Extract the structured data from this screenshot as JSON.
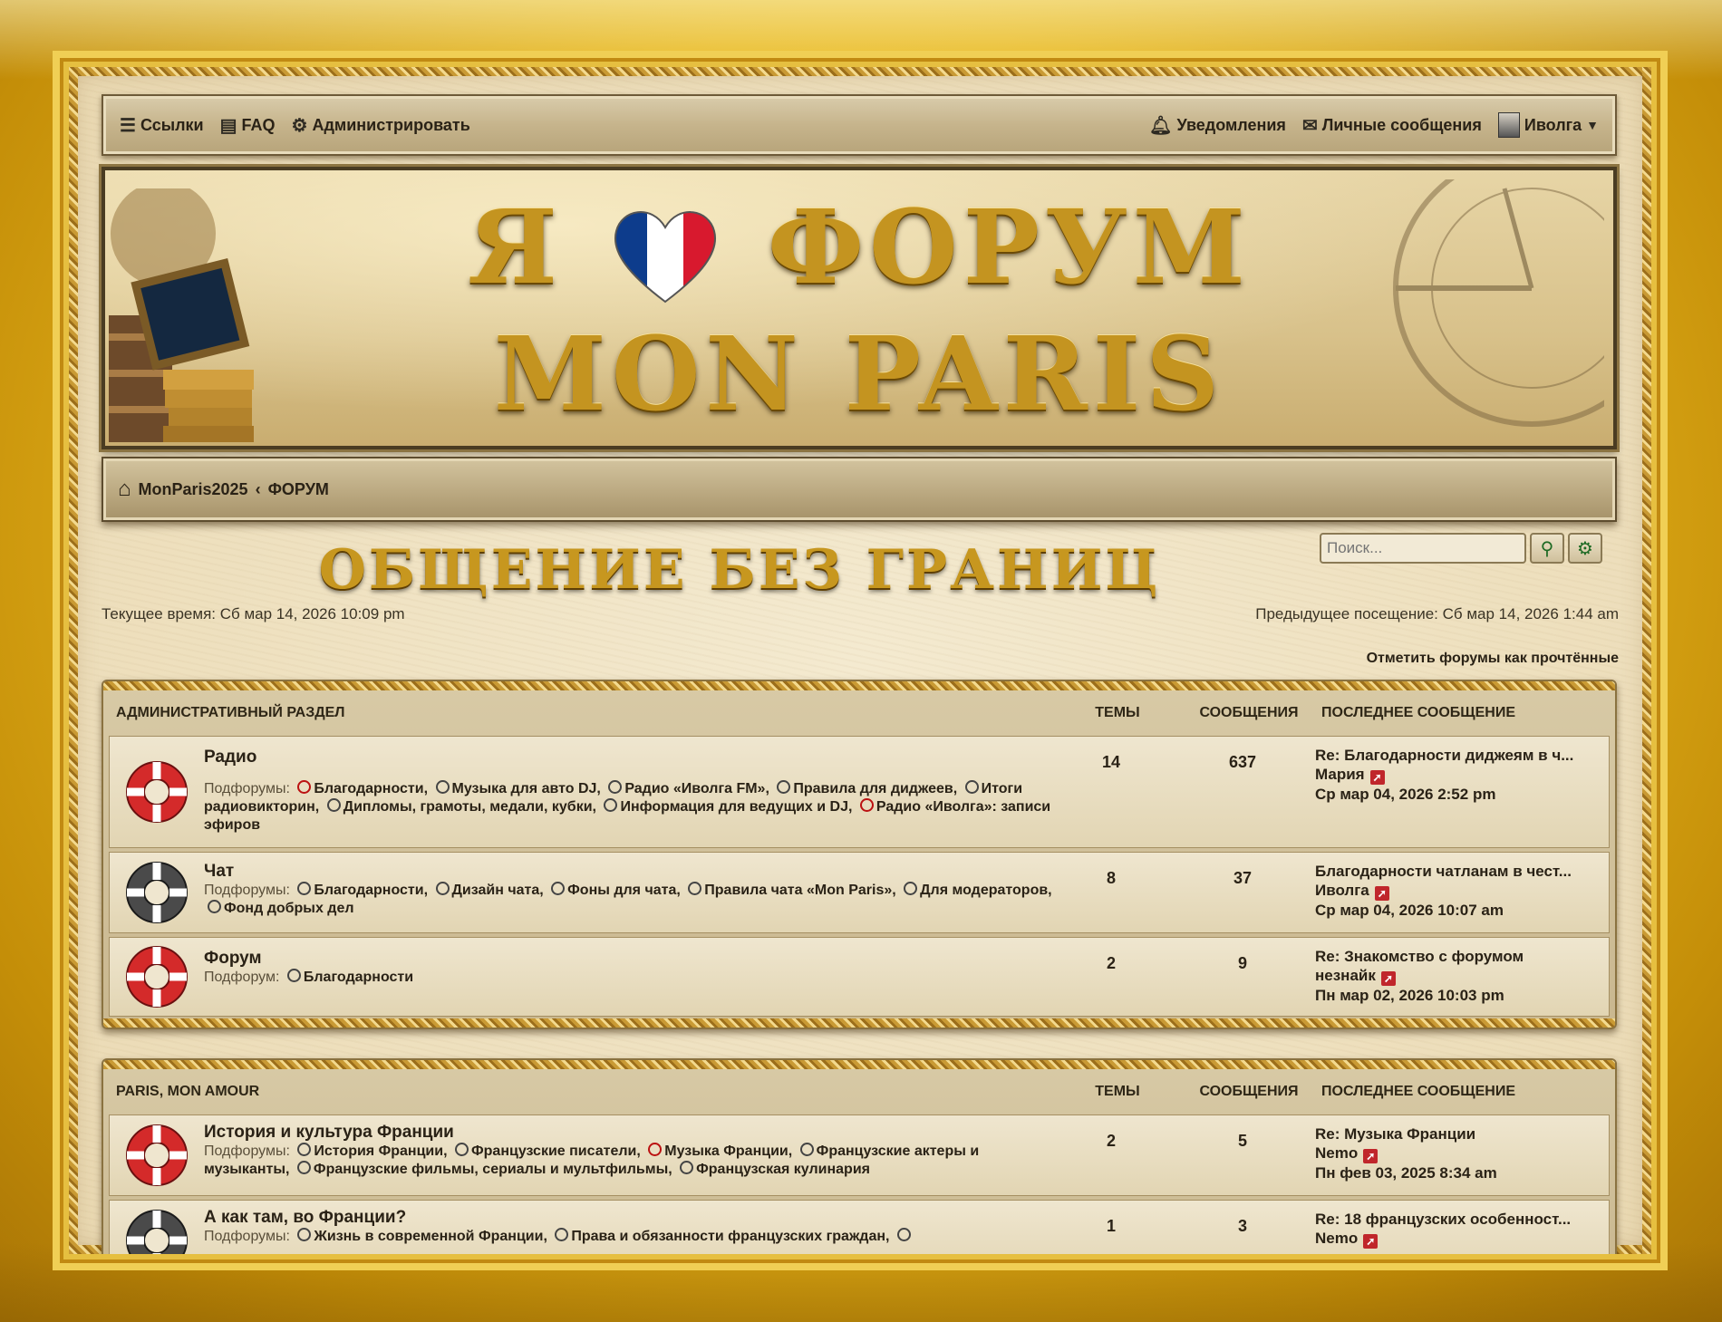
{
  "nav": {
    "links_label": "Ссылки",
    "faq_label": "FAQ",
    "admin_label": "Администрировать",
    "notifications_label": "Уведомления",
    "pm_label": "Личные сообщения",
    "user_label": "Иволга"
  },
  "banner": {
    "line1_left": "Я",
    "line1_right": "ФОРУМ",
    "line2": "MON PARIS"
  },
  "breadcrumb": {
    "home": "MonParis2025",
    "separator": "‹",
    "current": "ФОРУМ"
  },
  "subtitle": "ОБЩЕНИЕ БЕЗ ГРАНИЦ",
  "search": {
    "placeholder": "Поиск..."
  },
  "times": {
    "current": "Текущее время: Сб мар 14, 2026 10:09 pm",
    "previous": "Предыдущее посещение: Сб мар 14, 2026 1:44 am"
  },
  "mark_read": "Отметить форумы как прочтённые",
  "columns": {
    "topics": "Темы",
    "posts": "Сообщения",
    "last": "Последнее сообщение"
  },
  "sections": [
    {
      "title": "Административный раздел",
      "forums": [
        {
          "name": "Радио",
          "subs_label": "Подфорумы:",
          "subs": [
            "Благодарности,",
            "Музыка для авто DJ,",
            "Радио «Иволга FM»,",
            "Правила для диджеев,",
            "Итоги радиовикторин,",
            "Дипломы, грамоты, медали, кубки,",
            "Информация для ведущих и DJ,",
            "Радио «Иволга»: записи эфиров"
          ],
          "topics": "14",
          "posts": "637",
          "last_title": "Re: Благодарности диджеям в ч...",
          "last_user": "Мария",
          "last_date": "Ср мар 04, 2026 2:52 pm"
        },
        {
          "name": "Чат",
          "subs_label": "Подфорумы:",
          "subs": [
            "Благодарности,",
            "Дизайн чата,",
            "Фоны для чата,",
            "Правила чата «Mon Paris»,",
            "Для модераторов,",
            "Фонд добрых дел"
          ],
          "topics": "8",
          "posts": "37",
          "last_title": "Благодарности чатланам в чест...",
          "last_user": "Иволга",
          "last_date": "Ср мар 04, 2026 10:07 am"
        },
        {
          "name": "Форум",
          "subs_label": "Подфорум:",
          "subs": [
            "Благодарности"
          ],
          "topics": "2",
          "posts": "9",
          "last_title": "Re: Знакомство с форумом",
          "last_user": "незнайк",
          "last_date": "Пн мар 02, 2026 10:03 pm"
        }
      ]
    },
    {
      "title": "Paris, mon amour",
      "forums": [
        {
          "name": "История и культура Франции",
          "subs_label": "Подфорумы:",
          "subs": [
            "История Франции,",
            "Французские писатели,",
            "Музыка Франции,",
            "Французские актеры и музыканты,",
            "Французские фильмы, сериалы и мультфильмы,",
            "Французская кулинария"
          ],
          "topics": "2",
          "posts": "5",
          "last_title": "Re: Музыка Франции",
          "last_user": "Nemo",
          "last_date": "Пн фев 03, 2025 8:34 am"
        },
        {
          "name": "А как там, во Франции?",
          "subs_label": "Подфорумы:",
          "subs": [
            "Жизнь в современной Франции,",
            "Права и обязанности французских граждан,"
          ],
          "topics": "1",
          "posts": "3",
          "last_title": "Re: 18 французских особенност...",
          "last_user": "Nemo",
          "last_date": ""
        }
      ]
    }
  ],
  "colors": {
    "gold": "#c7971f",
    "frame": "#e7b61e",
    "red_icon": "#d42a2a",
    "gray_icon": "#555555"
  }
}
